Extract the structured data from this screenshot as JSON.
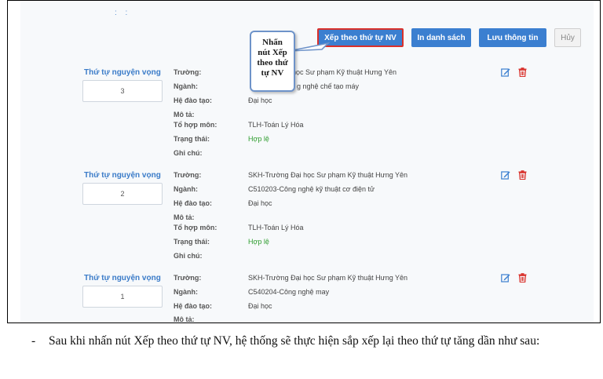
{
  "toolbar": {
    "sort_label": "Xếp theo thứ tự NV",
    "print_label": "In danh sách",
    "save_label": "Lưu thông tin",
    "cancel_label": "Hủy"
  },
  "callout": {
    "line1": "Nhấn",
    "line2": "nút Xếp",
    "line3": "theo thứ",
    "line4": "tự NV"
  },
  "field_labels": {
    "order": "Thứ tự nguyện vọng",
    "school": "Trường:",
    "major": "Ngành:",
    "mode": "Hệ đào tạo:",
    "desc": "Mô tả:",
    "combo": "Tổ hợp môn:",
    "status": "Trạng thái:",
    "note": "Ghi chú:"
  },
  "records": [
    {
      "order": "3",
      "school": "Đại học Sư phạm Kỹ thuật Hưng Yên",
      "major": "g nghệ chế tạo máy",
      "mode": "Đại học",
      "combo": "TLH-Toán Lý Hóa",
      "status": "Hợp lệ"
    },
    {
      "order": "2",
      "school": "SKH-Trường Đại học Sư phạm Kỹ thuật Hưng Yên",
      "major": "C510203-Công nghệ kỹ thuật cơ điện tử",
      "mode": "Đại học",
      "combo": "TLH-Toán Lý Hóa",
      "status": "Hợp lệ"
    },
    {
      "order": "1",
      "school": "SKH-Trường Đại học Sư phạm Kỹ thuật Hưng Yên",
      "major": "C540204-Công nghệ may",
      "mode": "Đại học"
    }
  ],
  "caption": {
    "bullet": "-",
    "text": "Sau khi nhấn nút Xếp theo thứ tự NV, hệ thống sẽ thực hiện sắp xếp lại theo thứ tự tăng dần như sau:"
  },
  "colors": {
    "accent": "#3b7fd0",
    "highlight_border": "#d9302b",
    "valid": "#2e9d2e",
    "label_blue": "#3a7bc8"
  }
}
